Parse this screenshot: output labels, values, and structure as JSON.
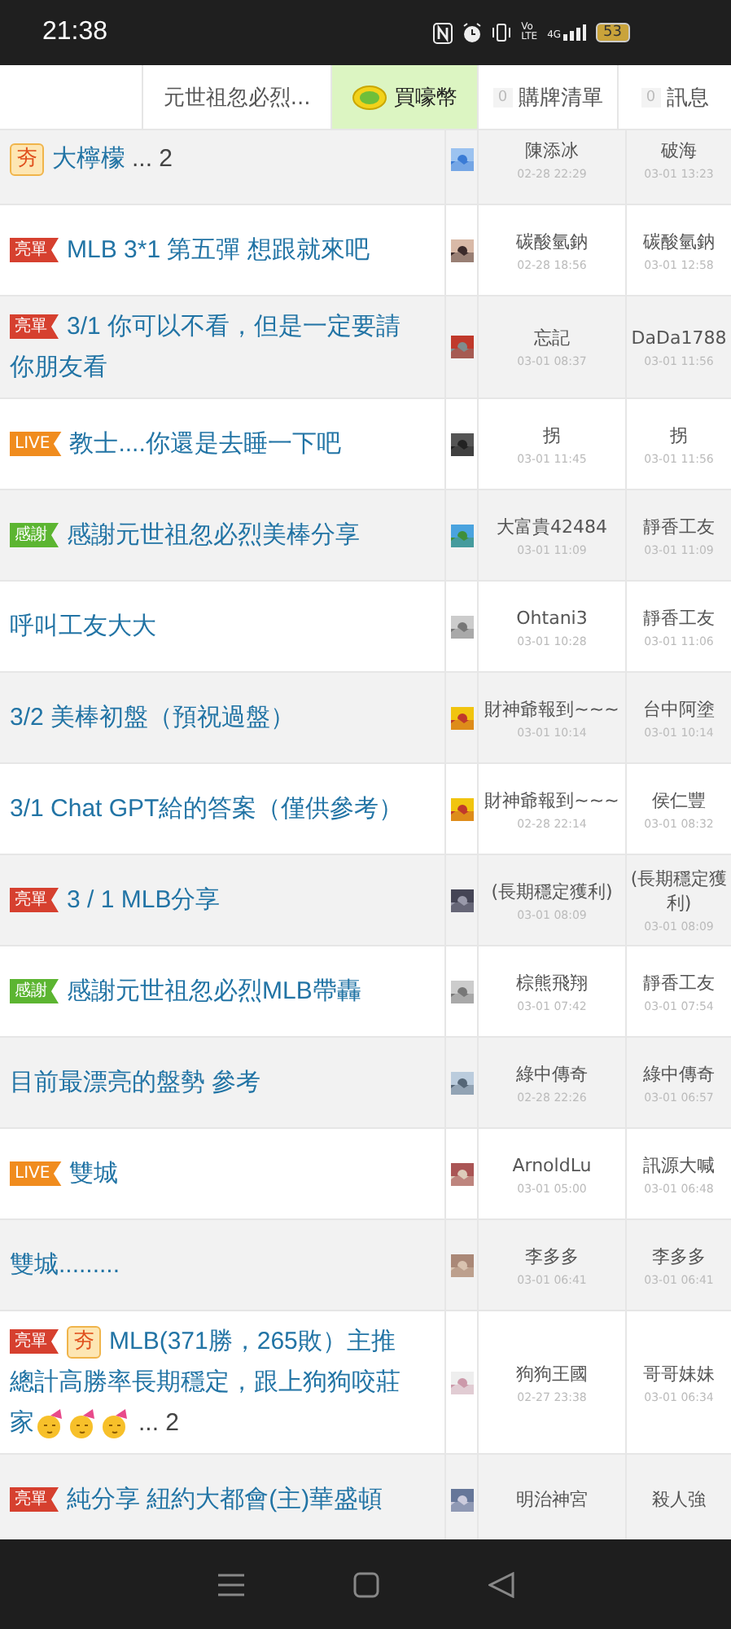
{
  "status_bar": {
    "time": "21:38",
    "volte": "Vo LTE",
    "network": "4G",
    "battery": "53"
  },
  "header": {
    "tabs": [
      {
        "kind": "plain",
        "label": "元世祖忽必烈...",
        "selected": false
      },
      {
        "kind": "coin",
        "label": "買嚎幣",
        "selected": true
      },
      {
        "kind": "count",
        "badge": "0",
        "label": "購牌清單",
        "selected": false
      },
      {
        "kind": "count",
        "badge": "0",
        "label": "訊息",
        "selected": false
      }
    ]
  },
  "threads": [
    {
      "tags": [
        {
          "kind": "hot",
          "label": "夯"
        }
      ],
      "title_lines": [
        "大檸檬"
      ],
      "pages": "... 2",
      "author": "陳添冰",
      "author_time": "02-28 22:29",
      "last_reply": "破海",
      "last_time": "03-01 13:23"
    },
    {
      "tags": [
        {
          "kind": "win",
          "label": "亮單"
        }
      ],
      "title_lines": [
        "MLB 3*1 第五彈 想跟就來吧"
      ],
      "author": "碳酸氫鈉",
      "author_time": "02-28 18:56",
      "last_reply": "碳酸氫鈉",
      "last_time": "03-01 12:58"
    },
    {
      "tags": [
        {
          "kind": "win",
          "label": "亮單"
        }
      ],
      "title_lines": [
        "3/1 你可以不看，但是一定要請",
        "你朋友看"
      ],
      "author": "忘記",
      "author_time": "03-01 08:37",
      "last_reply": "DaDa1788",
      "last_time": "03-01 11:56"
    },
    {
      "tags": [
        {
          "kind": "live",
          "label": "LIVE"
        }
      ],
      "title_lines": [
        "教士....你還是去睡一下吧"
      ],
      "author": "拐",
      "author_time": "03-01 11:45",
      "last_reply": "拐",
      "last_time": "03-01 11:56"
    },
    {
      "tags": [
        {
          "kind": "thanks",
          "label": "感謝"
        }
      ],
      "title_lines": [
        "感謝元世祖忽必烈美棒分享"
      ],
      "author": "大富貴42484",
      "author_time": "03-01 11:09",
      "last_reply": "靜香工友",
      "last_time": "03-01 11:09"
    },
    {
      "title_lines": [
        "呼叫工友大大"
      ],
      "author": "Ohtani3",
      "author_time": "03-01 10:28",
      "last_reply": "靜香工友",
      "last_time": "03-01 11:06"
    },
    {
      "title_lines": [
        "3/2 美棒初盤（預祝過盤）"
      ],
      "author": "財神爺報到~~~",
      "author_time": "03-01 10:14",
      "last_reply": "台中阿塗",
      "last_time": "03-01 10:14"
    },
    {
      "title_lines": [
        "3/1 Chat GPT給的答案（僅供參考）"
      ],
      "author": "財神爺報到~~~",
      "author_time": "02-28 22:14",
      "last_reply": "侯仁豐",
      "last_time": "03-01 08:32"
    },
    {
      "tags": [
        {
          "kind": "win",
          "label": "亮單"
        }
      ],
      "title_lines": [
        "3 / 1 MLB分享"
      ],
      "author": "(長期穩定獲利)",
      "author_time": "03-01 08:09",
      "last_reply": "(長期穩定獲利)",
      "last_time": "03-01 08:09"
    },
    {
      "tags": [
        {
          "kind": "thanks",
          "label": "感謝"
        }
      ],
      "title_lines": [
        "感謝元世祖忽必烈MLB帶轟"
      ],
      "author": "棕熊飛翔",
      "author_time": "03-01 07:42",
      "last_reply": "靜香工友",
      "last_time": "03-01 07:54"
    },
    {
      "title_lines": [
        "目前最漂亮的盤勢 參考"
      ],
      "author": "綠中傳奇",
      "author_time": "02-28 22:26",
      "last_reply": "綠中傳奇",
      "last_time": "03-01 06:57"
    },
    {
      "tags": [
        {
          "kind": "live",
          "label": "LIVE"
        }
      ],
      "title_lines": [
        "雙城"
      ],
      "author": "ArnoldLu",
      "author_time": "03-01 05:00",
      "last_reply": "訊源大喊",
      "last_time": "03-01 06:48"
    },
    {
      "title_lines": [
        "雙城........."
      ],
      "author": "李多多",
      "author_time": "03-01 06:41",
      "last_reply": "李多多",
      "last_time": "03-01 06:41"
    },
    {
      "tags": [
        {
          "kind": "win",
          "label": "亮單"
        },
        {
          "kind": "hot",
          "label": "夯"
        }
      ],
      "title_lines": [
        "MLB(371勝，265敗）主推",
        "總計高勝率長期穩定，跟上狗狗咬莊",
        "家"
      ],
      "emojis": [
        {
          "kind": "party"
        },
        {
          "kind": "party"
        },
        {
          "kind": "party"
        }
      ],
      "pages": "... 2",
      "author": "狗狗王國",
      "author_time": "02-27 23:38",
      "last_reply": "哥哥妹妹",
      "last_time": "03-01 06:34"
    },
    {
      "tags": [
        {
          "kind": "win",
          "label": "亮單"
        }
      ],
      "title_lines": [
        "純分享 紐約大都會(主)華盛頓"
      ],
      "author": "明治神宮",
      "last_reply": "殺人強"
    }
  ]
}
